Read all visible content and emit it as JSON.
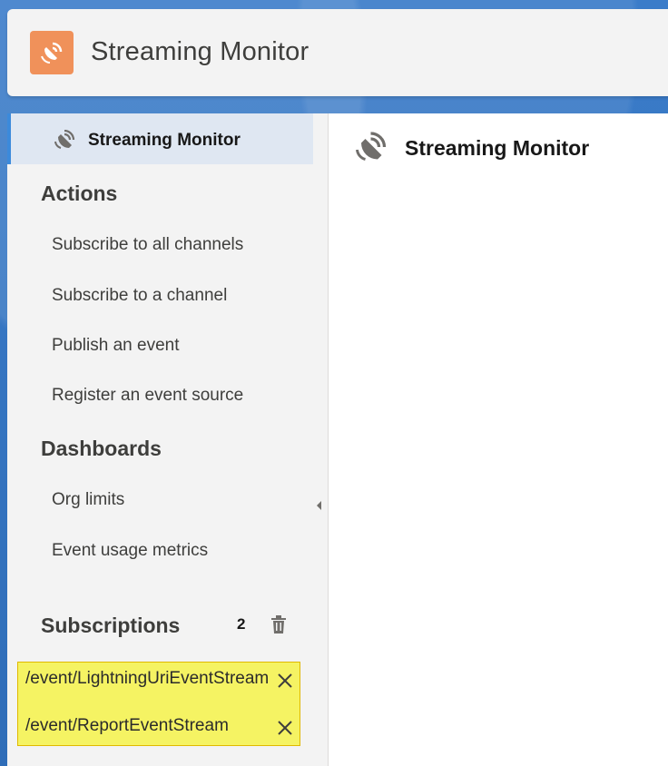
{
  "header": {
    "app_title": "Streaming Monitor",
    "icon": "satellite-dish-icon",
    "icon_bg": "#f0915a"
  },
  "sidebar": {
    "active_item": "Streaming Monitor",
    "active_accent": "#3c8adb",
    "actions_title": "Actions",
    "actions": [
      "Subscribe to all channels",
      "Subscribe to a channel",
      "Publish an event",
      "Register an event source"
    ],
    "dashboards_title": "Dashboards",
    "dashboards": [
      "Org limits",
      "Event usage metrics"
    ],
    "subscriptions_title": "Subscriptions",
    "subscriptions_count": "2",
    "subscriptions": [
      "/event/LightningUriEventStream",
      "/event/ReportEventStream"
    ],
    "highlight_color": "#f5f363"
  },
  "main": {
    "title": "Streaming Monitor"
  }
}
